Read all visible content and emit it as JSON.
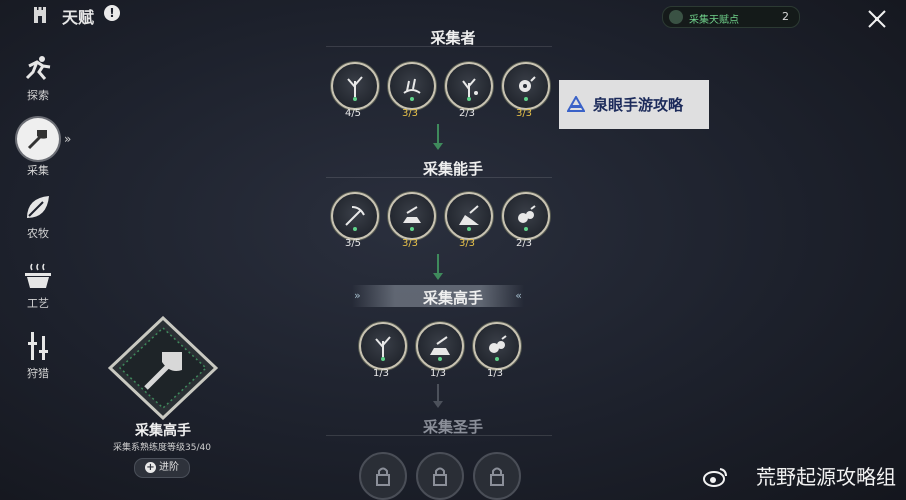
{
  "header": {
    "title": "天赋",
    "info_symbol": "!"
  },
  "points": {
    "label": "采集天赋点",
    "count": "2"
  },
  "sidebar": {
    "items": [
      {
        "label": "探索",
        "icon": "runner-icon"
      },
      {
        "label": "采集",
        "icon": "axe-icon",
        "active": true
      },
      {
        "label": "农牧",
        "icon": "leaf-icon"
      },
      {
        "label": "工艺",
        "icon": "pot-icon"
      },
      {
        "label": "狩猎",
        "icon": "tools-icon"
      }
    ],
    "active_arrow": "»"
  },
  "tiers": [
    {
      "title": "采集者",
      "nodes": [
        {
          "count": "4/5"
        },
        {
          "count": "3/3"
        },
        {
          "count": "2/3"
        },
        {
          "count": "3/3"
        }
      ]
    },
    {
      "title": "采集能手",
      "nodes": [
        {
          "count": "3/5"
        },
        {
          "count": "3/3"
        },
        {
          "count": "3/3"
        },
        {
          "count": "2/3"
        }
      ]
    },
    {
      "title": "采集高手",
      "nodes": [
        {
          "count": "1/3"
        },
        {
          "count": "1/3"
        },
        {
          "count": "1/3"
        }
      ]
    },
    {
      "title": "采集圣手",
      "locked": true
    }
  ],
  "rank_card": {
    "title": "采集高手",
    "subtitle": "采集系熟练度等级35/40",
    "button": "进阶"
  },
  "watermarks": {
    "box": "泉眼手游攻略",
    "bottom": "荒野起源攻略组"
  },
  "colors": {
    "accent_green": "#3f8a5c",
    "max_yellow": "#e8c24a"
  }
}
